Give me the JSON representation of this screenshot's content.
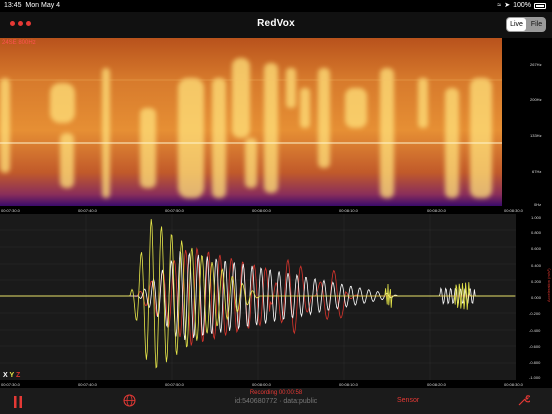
{
  "status": {
    "time": "13:45",
    "date": "Mon May 4",
    "battery": "100%"
  },
  "header": {
    "title": "RedVox",
    "live_label": "Live",
    "file_label": "File"
  },
  "spectrogram": {
    "overlay_label": "24SE 800Hz",
    "freq_labels": [
      "267Hz",
      "200Hz",
      "133Hz",
      "67Hz",
      "0Hz"
    ],
    "time_labels": [
      "00:07:30.0",
      "00:07:40.0",
      "00:07:50.0",
      "00:08:00.0",
      "00:08:10.0",
      "00:08:20.0",
      "00:08:30.0"
    ]
  },
  "waveform": {
    "y_labels": [
      "1.000",
      "0.800",
      "0.600",
      "0.400",
      "0.200",
      "0.000",
      "-0.200",
      "-0.400",
      "-0.600",
      "-0.800",
      "-1.000"
    ],
    "y_axis_title": "Acceleration (m/s²)",
    "time_labels": [
      "00:07:30.0",
      "00:07:40.0",
      "00:07:50.0",
      "00:08:00.0",
      "00:08:10.0",
      "00:08:20.0",
      "00:08:30.0"
    ],
    "legend": {
      "x": "X",
      "y": "Y",
      "z": "Z"
    },
    "colors": {
      "x": "#ffffff",
      "y": "#e8e84a",
      "z": "#d8342c"
    }
  },
  "bottom": {
    "recording": "Recording 00:00:58",
    "id_line": "id:540680772 · data:public",
    "sensor_label": "Sensor"
  }
}
